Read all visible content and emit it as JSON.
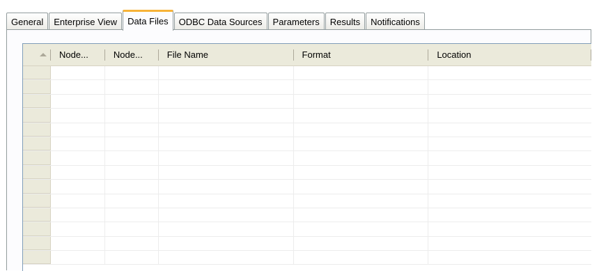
{
  "tabs": [
    {
      "label": "General",
      "active": false
    },
    {
      "label": "Enterprise View",
      "active": false
    },
    {
      "label": "Data Files",
      "active": true
    },
    {
      "label": "ODBC Data Sources",
      "active": false
    },
    {
      "label": "Parameters",
      "active": false
    },
    {
      "label": "Results",
      "active": false
    },
    {
      "label": "Notifications",
      "active": false
    }
  ],
  "table": {
    "columns": [
      "Node...",
      "Node...",
      "File Name",
      "Format",
      "Location"
    ],
    "sort_icon": "sort-ascending-icon",
    "rows": []
  },
  "colors": {
    "active_tab_accent": "#f7b338",
    "header_bg": "#ebeadb",
    "border": "#919b9c"
  }
}
